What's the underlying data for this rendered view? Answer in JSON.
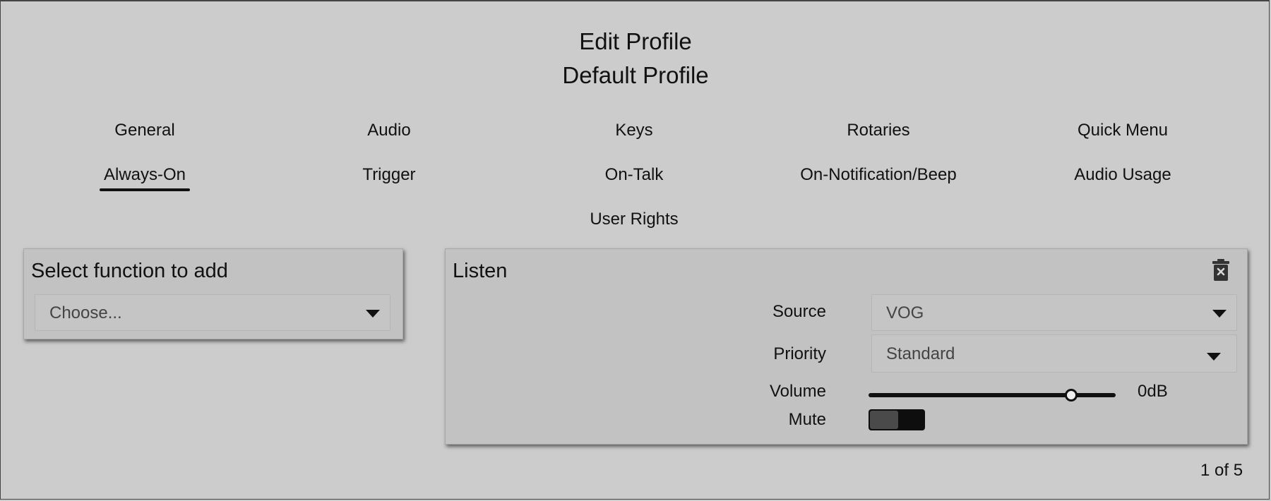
{
  "header": {
    "title": "Edit Profile",
    "subtitle": "Default Profile"
  },
  "tabs": [
    {
      "label": "General"
    },
    {
      "label": "Audio"
    },
    {
      "label": "Keys"
    },
    {
      "label": "Rotaries"
    },
    {
      "label": "Quick Menu"
    },
    {
      "label": "Always-On",
      "active": true
    },
    {
      "label": "Trigger"
    },
    {
      "label": "On-Talk"
    },
    {
      "label": "On-Notification/Beep"
    },
    {
      "label": "Audio Usage"
    },
    {
      "label": "User Rights"
    }
  ],
  "add_function": {
    "title": "Select function to add",
    "select_value": "Choose...",
    "select_icon": "caret-down-icon"
  },
  "listen": {
    "title": "Listen",
    "delete_icon": "trash-icon",
    "source_label": "Source",
    "source_value": "VOG",
    "priority_label": "Priority",
    "priority_value": "Standard",
    "volume_label": "Volume",
    "volume_value": "0dB",
    "volume_level": 0.82,
    "mute_label": "Mute",
    "mute_on": false
  },
  "pager": {
    "text": "1 of 5"
  },
  "colors": {
    "background": "#cccccc",
    "card": "#c2c2c2",
    "text": "#111111",
    "muted_text": "#444444"
  }
}
